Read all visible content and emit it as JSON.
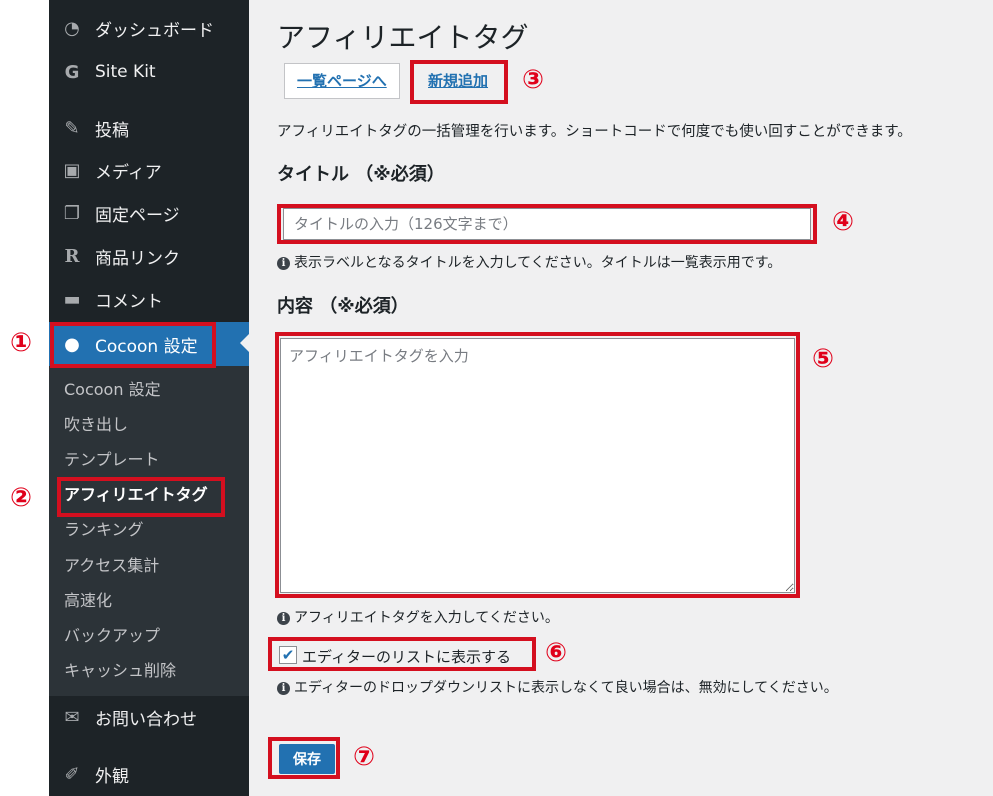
{
  "sidebar": {
    "items": [
      {
        "label": "ダッシュボード",
        "icon": "dashboard-icon",
        "glyph": "◔"
      },
      {
        "label": "Site Kit",
        "icon": "site-kit-icon",
        "glyph": "G"
      },
      {
        "label": "投稿",
        "icon": "pin-icon",
        "glyph": "✎"
      },
      {
        "label": "メディア",
        "icon": "media-icon",
        "glyph": "▣"
      },
      {
        "label": "固定ページ",
        "icon": "pages-icon",
        "glyph": "❐"
      },
      {
        "label": "商品リンク",
        "icon": "rinker-icon",
        "glyph": "R"
      },
      {
        "label": "コメント",
        "icon": "comment-icon",
        "glyph": "▬"
      },
      {
        "label": "Cocoon 設定",
        "icon": "cocoon-icon",
        "glyph": "●"
      },
      {
        "label": "お問い合わせ",
        "icon": "mail-icon",
        "glyph": "✉"
      },
      {
        "label": "外観",
        "icon": "appearance-icon",
        "glyph": "✐"
      }
    ],
    "submenu": [
      "Cocoon 設定",
      "吹き出し",
      "テンプレート",
      "アフィリエイトタグ",
      "ランキング",
      "アクセス集計",
      "高速化",
      "バックアップ",
      "キャッシュ削除"
    ]
  },
  "main": {
    "title": "アフィリエイトタグ",
    "tabs": [
      "一覧ページへ",
      "新規追加"
    ],
    "description": "アフィリエイトタグの一括管理を行います。ショートコードで何度でも使い回すことができます。",
    "title_field": {
      "label": "タイトル （※必須）",
      "placeholder": "タイトルの入力（126文字まで）",
      "help": "表示ラベルとなるタイトルを入力してください。タイトルは一覧表示用です。"
    },
    "content_field": {
      "label": "内容 （※必須）",
      "placeholder": "アフィリエイトタグを入力",
      "help": "アフィリエイトタグを入力してください。"
    },
    "checkbox": {
      "label": "エディターのリストに表示する",
      "checked": true,
      "help": "エディターのドロップダウンリストに表示しなくて良い場合は、無効にしてください。"
    },
    "save_label": "保存"
  },
  "annotations": [
    "①",
    "②",
    "③",
    "④",
    "⑤",
    "⑥",
    "⑦"
  ],
  "colors": {
    "annotation": "#d40f1f",
    "accent": "#2271b1",
    "sidebar": "#1d2327"
  }
}
